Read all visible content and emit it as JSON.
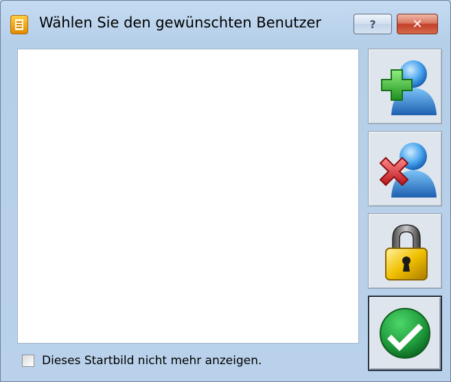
{
  "window": {
    "title": "Wählen Sie den gewünschten Benutzer",
    "help_glyph": "?",
    "close_glyph": "✕"
  },
  "users_list": {
    "items": []
  },
  "side_buttons": [
    {
      "name": "add-user-button",
      "icon": "add-user-icon"
    },
    {
      "name": "remove-user-button",
      "icon": "remove-user-icon"
    },
    {
      "name": "lock-button",
      "icon": "padlock-icon"
    },
    {
      "name": "ok-button",
      "icon": "checkmark-icon",
      "default": true
    }
  ],
  "startup_option": {
    "checked": false,
    "label": "Dieses Startbild nicht mehr anzeigen."
  },
  "colors": {
    "window_background": "#b9d1ea",
    "close_button": "#c2402a",
    "add_green": "#2ea82e",
    "remove_red": "#d8242a",
    "lock_gold": "#e8b800",
    "ok_green": "#1f9a3a"
  }
}
